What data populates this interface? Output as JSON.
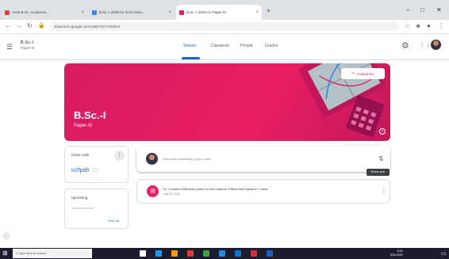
{
  "browser": {
    "tabs": [
      {
        "label": "Amul B.Sc. Academic...",
        "favicon_color": "#ea4335"
      },
      {
        "label": "B.Sc.-I 2020-21 Tech Histo...",
        "favicon_color": "#4285f4"
      },
      {
        "label": "B.Sc.-I 2020-21 Paper-III",
        "favicon_color": "#e91e63"
      }
    ],
    "new_tab": "+",
    "address": "classroom.google.com/c/MjYzOTY0NDU1",
    "window_controls": [
      "–",
      "□",
      "✕"
    ]
  },
  "classroom": {
    "class_name": "B.Sc.-I",
    "class_section": "Paper-III",
    "nav_tabs": [
      "Stream",
      "Classwork",
      "People",
      "Grades"
    ],
    "active_tab": "Stream",
    "banner": {
      "title": "B.Sc.-I",
      "subtitle": "Paper-III",
      "customize_label": "Customize",
      "color": "#e91e63"
    },
    "class_code": {
      "label": "Class code",
      "value": "iv2fpdh"
    },
    "upcoming": {
      "label": "Upcoming",
      "text": "No work due soon",
      "view_all": "View all"
    },
    "announce": {
      "placeholder": "Announce something to your class"
    },
    "tooltip": "Reuse post",
    "stream_items": [
      {
        "text": "Dr. Lomasha Mahanta posted a new material: Differential Equation 1 class",
        "date": "May 30, 2020"
      }
    ]
  },
  "taskbar": {
    "search_placeholder": "Type here to search",
    "time": "8:32",
    "date": "5/31/2020",
    "icon_colors": [
      "#ffffff",
      "#2196f3",
      "#ff9800",
      "#e53935",
      "#43a047",
      "#1e88e5",
      "#0078d7",
      "#d32f2f",
      "#1565c0"
    ]
  }
}
